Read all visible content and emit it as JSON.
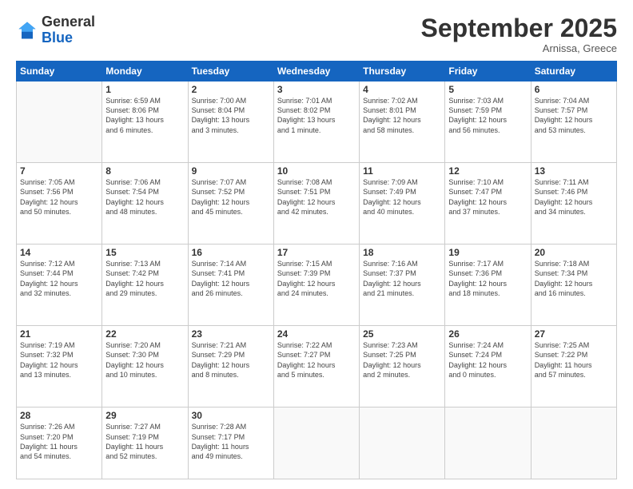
{
  "header": {
    "logo_general": "General",
    "logo_blue": "Blue",
    "month_title": "September 2025",
    "location": "Arnissa, Greece"
  },
  "weekdays": [
    "Sunday",
    "Monday",
    "Tuesday",
    "Wednesday",
    "Thursday",
    "Friday",
    "Saturday"
  ],
  "weeks": [
    [
      {
        "day": "",
        "info": ""
      },
      {
        "day": "1",
        "info": "Sunrise: 6:59 AM\nSunset: 8:06 PM\nDaylight: 13 hours\nand 6 minutes."
      },
      {
        "day": "2",
        "info": "Sunrise: 7:00 AM\nSunset: 8:04 PM\nDaylight: 13 hours\nand 3 minutes."
      },
      {
        "day": "3",
        "info": "Sunrise: 7:01 AM\nSunset: 8:02 PM\nDaylight: 13 hours\nand 1 minute."
      },
      {
        "day": "4",
        "info": "Sunrise: 7:02 AM\nSunset: 8:01 PM\nDaylight: 12 hours\nand 58 minutes."
      },
      {
        "day": "5",
        "info": "Sunrise: 7:03 AM\nSunset: 7:59 PM\nDaylight: 12 hours\nand 56 minutes."
      },
      {
        "day": "6",
        "info": "Sunrise: 7:04 AM\nSunset: 7:57 PM\nDaylight: 12 hours\nand 53 minutes."
      }
    ],
    [
      {
        "day": "7",
        "info": "Sunrise: 7:05 AM\nSunset: 7:56 PM\nDaylight: 12 hours\nand 50 minutes."
      },
      {
        "day": "8",
        "info": "Sunrise: 7:06 AM\nSunset: 7:54 PM\nDaylight: 12 hours\nand 48 minutes."
      },
      {
        "day": "9",
        "info": "Sunrise: 7:07 AM\nSunset: 7:52 PM\nDaylight: 12 hours\nand 45 minutes."
      },
      {
        "day": "10",
        "info": "Sunrise: 7:08 AM\nSunset: 7:51 PM\nDaylight: 12 hours\nand 42 minutes."
      },
      {
        "day": "11",
        "info": "Sunrise: 7:09 AM\nSunset: 7:49 PM\nDaylight: 12 hours\nand 40 minutes."
      },
      {
        "day": "12",
        "info": "Sunrise: 7:10 AM\nSunset: 7:47 PM\nDaylight: 12 hours\nand 37 minutes."
      },
      {
        "day": "13",
        "info": "Sunrise: 7:11 AM\nSunset: 7:46 PM\nDaylight: 12 hours\nand 34 minutes."
      }
    ],
    [
      {
        "day": "14",
        "info": "Sunrise: 7:12 AM\nSunset: 7:44 PM\nDaylight: 12 hours\nand 32 minutes."
      },
      {
        "day": "15",
        "info": "Sunrise: 7:13 AM\nSunset: 7:42 PM\nDaylight: 12 hours\nand 29 minutes."
      },
      {
        "day": "16",
        "info": "Sunrise: 7:14 AM\nSunset: 7:41 PM\nDaylight: 12 hours\nand 26 minutes."
      },
      {
        "day": "17",
        "info": "Sunrise: 7:15 AM\nSunset: 7:39 PM\nDaylight: 12 hours\nand 24 minutes."
      },
      {
        "day": "18",
        "info": "Sunrise: 7:16 AM\nSunset: 7:37 PM\nDaylight: 12 hours\nand 21 minutes."
      },
      {
        "day": "19",
        "info": "Sunrise: 7:17 AM\nSunset: 7:36 PM\nDaylight: 12 hours\nand 18 minutes."
      },
      {
        "day": "20",
        "info": "Sunrise: 7:18 AM\nSunset: 7:34 PM\nDaylight: 12 hours\nand 16 minutes."
      }
    ],
    [
      {
        "day": "21",
        "info": "Sunrise: 7:19 AM\nSunset: 7:32 PM\nDaylight: 12 hours\nand 13 minutes."
      },
      {
        "day": "22",
        "info": "Sunrise: 7:20 AM\nSunset: 7:30 PM\nDaylight: 12 hours\nand 10 minutes."
      },
      {
        "day": "23",
        "info": "Sunrise: 7:21 AM\nSunset: 7:29 PM\nDaylight: 12 hours\nand 8 minutes."
      },
      {
        "day": "24",
        "info": "Sunrise: 7:22 AM\nSunset: 7:27 PM\nDaylight: 12 hours\nand 5 minutes."
      },
      {
        "day": "25",
        "info": "Sunrise: 7:23 AM\nSunset: 7:25 PM\nDaylight: 12 hours\nand 2 minutes."
      },
      {
        "day": "26",
        "info": "Sunrise: 7:24 AM\nSunset: 7:24 PM\nDaylight: 12 hours\nand 0 minutes."
      },
      {
        "day": "27",
        "info": "Sunrise: 7:25 AM\nSunset: 7:22 PM\nDaylight: 11 hours\nand 57 minutes."
      }
    ],
    [
      {
        "day": "28",
        "info": "Sunrise: 7:26 AM\nSunset: 7:20 PM\nDaylight: 11 hours\nand 54 minutes."
      },
      {
        "day": "29",
        "info": "Sunrise: 7:27 AM\nSunset: 7:19 PM\nDaylight: 11 hours\nand 52 minutes."
      },
      {
        "day": "30",
        "info": "Sunrise: 7:28 AM\nSunset: 7:17 PM\nDaylight: 11 hours\nand 49 minutes."
      },
      {
        "day": "",
        "info": ""
      },
      {
        "day": "",
        "info": ""
      },
      {
        "day": "",
        "info": ""
      },
      {
        "day": "",
        "info": ""
      }
    ]
  ]
}
